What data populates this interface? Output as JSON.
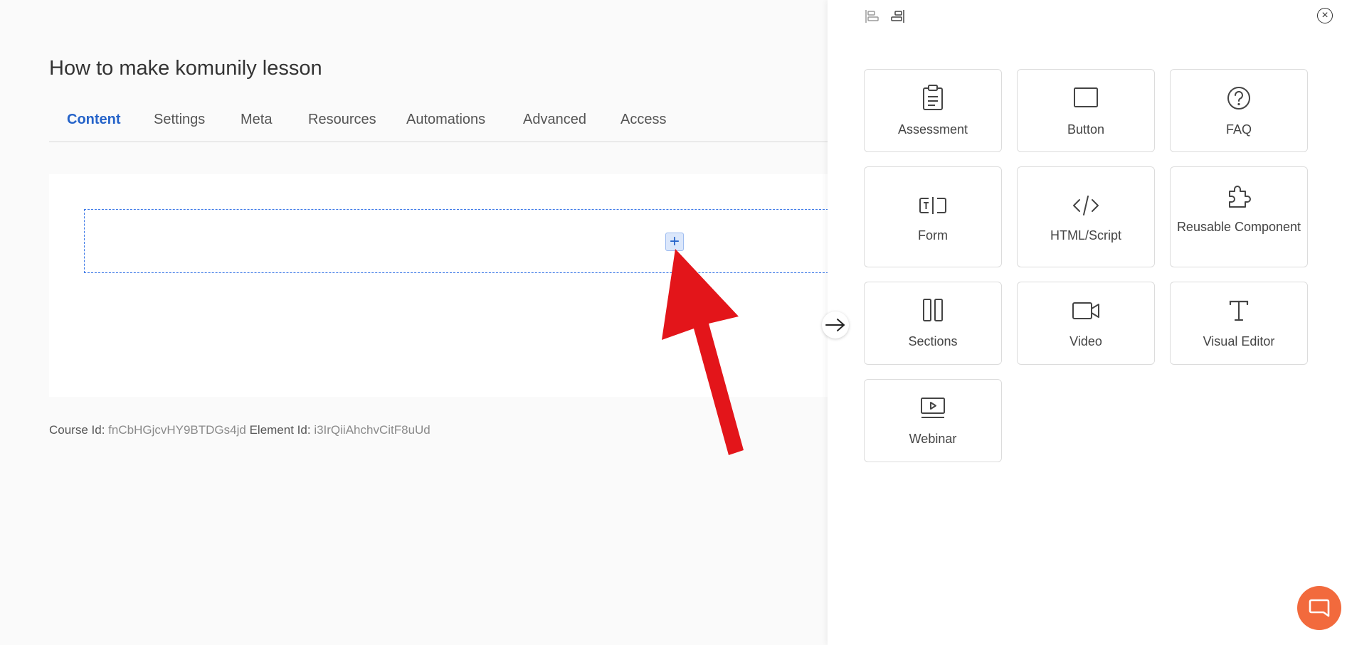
{
  "page": {
    "title": "How to make komunily lesson"
  },
  "tabs": [
    {
      "label": "Content",
      "active": true
    },
    {
      "label": "Settings",
      "active": false
    },
    {
      "label": "Meta",
      "active": false
    },
    {
      "label": "Resources",
      "active": false
    },
    {
      "label": "Automations",
      "active": false
    },
    {
      "label": "Advanced",
      "active": false
    },
    {
      "label": "Access",
      "active": false
    }
  ],
  "editor": {
    "add_symbol": "+"
  },
  "ids": {
    "course_label": "Course Id:",
    "course_value": "fnCbHGjcvHY9BTDGs4jd",
    "element_label": "Element Id:",
    "element_value": "i3IrQiiAhchvCitF8uUd"
  },
  "panel": {
    "close_symbol": "×",
    "elements": [
      {
        "label": "Assessment",
        "icon": "clipboard-icon"
      },
      {
        "label": "Button",
        "icon": "button-rectangle-icon"
      },
      {
        "label": "FAQ",
        "icon": "question-circle-icon"
      },
      {
        "label": "Form",
        "icon": "form-input-icon"
      },
      {
        "label": "HTML/Script",
        "icon": "code-icon"
      },
      {
        "label": "Reusable Component",
        "icon": "puzzle-icon"
      },
      {
        "label": "Sections",
        "icon": "columns-icon"
      },
      {
        "label": "Video",
        "icon": "video-camera-icon"
      },
      {
        "label": "Visual Editor",
        "icon": "text-t-icon"
      },
      {
        "label": "Webinar",
        "icon": "webinar-screen-icon"
      }
    ]
  },
  "colors": {
    "accent": "#2563c9",
    "annotation_arrow": "#e3151a",
    "chat_button": "#f26a3d"
  }
}
